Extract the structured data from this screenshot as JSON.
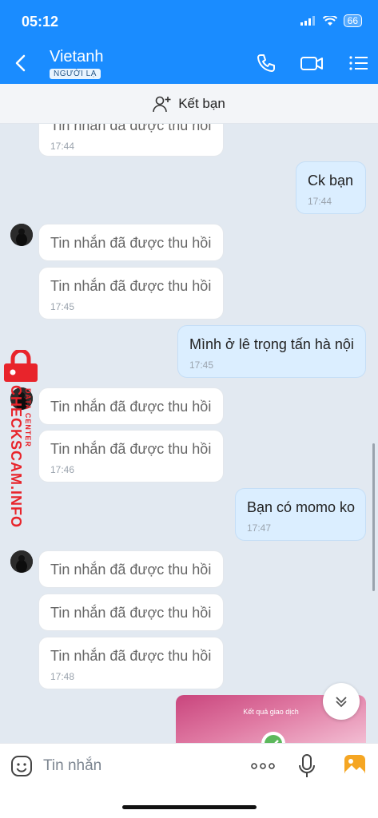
{
  "status": {
    "time": "05:12",
    "battery": "66"
  },
  "header": {
    "name": "Vietanh",
    "badge": "NGƯỜI LẠ"
  },
  "add_friend": {
    "label": "Kết bạn"
  },
  "messages": [
    {
      "text": "Tin nhắn đã được thu hồi",
      "time": "17:44"
    },
    {
      "text": "Ck bạn",
      "time": "17:44"
    },
    {
      "text": "Tin nhắn đã được thu hồi"
    },
    {
      "text": "Tin nhắn đã được thu hồi",
      "time": "17:45"
    },
    {
      "text": "Mình ở lê trọng tấn hà nội",
      "time": "17:45"
    },
    {
      "text": "Tin nhắn đã được thu hồi"
    },
    {
      "text": "Tin nhắn đã được thu hồi",
      "time": "17:46"
    },
    {
      "text": "Bạn có momo ko",
      "time": "17:47"
    },
    {
      "text": "Tin nhắn đã được thu hồi"
    },
    {
      "text": "Tin nhắn đã được thu hồi"
    },
    {
      "text": "Tin nhắn đã được thu hồi",
      "time": "17:48"
    }
  ],
  "receipt": {
    "title": "Kết quả giao dịch"
  },
  "watermark": {
    "brand": "CHECKSCAM.INFO",
    "sub": "DATA CENTER"
  },
  "input": {
    "placeholder": "Tin nhắn"
  },
  "colors": {
    "header": "#1a8cff",
    "my_bubble": "#dbeeff",
    "watermark": "#e8242b"
  }
}
